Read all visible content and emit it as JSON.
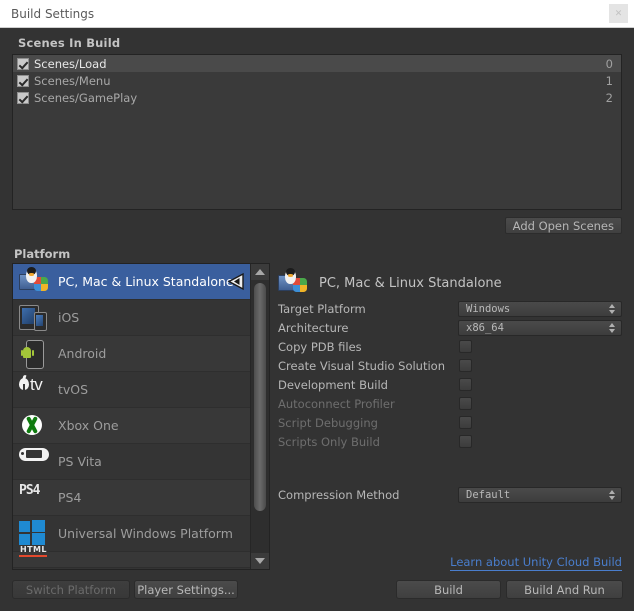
{
  "window": {
    "title": "Build Settings",
    "close_icon": "close-icon",
    "close_glyph": "✕"
  },
  "scenes_section": {
    "header": "Scenes In Build",
    "add_open_scenes_label": "Add Open Scenes",
    "scenes": [
      {
        "name": "Scenes/Load",
        "index": "0",
        "checked": true,
        "selected": true
      },
      {
        "name": "Scenes/Menu",
        "index": "1",
        "checked": true,
        "selected": false
      },
      {
        "name": "Scenes/GamePlay",
        "index": "2",
        "checked": true,
        "selected": false
      }
    ]
  },
  "platform_section": {
    "header": "Platform",
    "selected_platform": "PC, Mac & Linux Standalone",
    "active_target_icon": "unity-logo-icon",
    "scroll_up_icon": "scroll-up-arrow-icon",
    "scroll_down_icon": "scroll-down-arrow-icon",
    "platforms": [
      {
        "label": "PC, Mac & Linux Standalone",
        "icon": "standalone-icon",
        "selected": true
      },
      {
        "label": "iOS",
        "icon": "ios-icon",
        "selected": false
      },
      {
        "label": "Android",
        "icon": "android-icon",
        "selected": false
      },
      {
        "label": "tvOS",
        "icon": "tvos-icon",
        "selected": false
      },
      {
        "label": "Xbox One",
        "icon": "xbox-one-icon",
        "selected": false
      },
      {
        "label": "PS Vita",
        "icon": "ps-vita-icon",
        "selected": false
      },
      {
        "label": "PS4",
        "icon": "ps4-icon",
        "selected": false
      },
      {
        "label": "Universal Windows Platform",
        "icon": "windows-icon",
        "selected": false
      },
      {
        "label": "",
        "icon": "html5-icon",
        "selected": false
      }
    ]
  },
  "settings_panel": {
    "title": "PC, Mac & Linux Standalone",
    "title_icon": "standalone-icon",
    "fields": [
      {
        "label": "Target Platform",
        "type": "popup",
        "value": "Windows",
        "disabled": false
      },
      {
        "label": "Architecture",
        "type": "popup",
        "value": "x86_64",
        "disabled": false
      },
      {
        "label": "Copy PDB files",
        "type": "checkbox",
        "value": false,
        "disabled": false
      },
      {
        "label": "Create Visual Studio Solution",
        "type": "checkbox",
        "value": false,
        "disabled": false
      },
      {
        "label": "Development Build",
        "type": "checkbox",
        "value": false,
        "disabled": false
      },
      {
        "label": "Autoconnect Profiler",
        "type": "checkbox",
        "value": false,
        "disabled": true
      },
      {
        "label": "Script Debugging",
        "type": "checkbox",
        "value": false,
        "disabled": true
      },
      {
        "label": "Scripts Only Build",
        "type": "checkbox",
        "value": false,
        "disabled": true
      }
    ],
    "compression": {
      "label": "Compression Method",
      "value": "Default"
    }
  },
  "footer": {
    "cloud_build_link": "Learn about Unity Cloud Build",
    "switch_platform_label": "Switch Platform",
    "switch_platform_disabled": true,
    "player_settings_label": "Player Settings...",
    "build_label": "Build",
    "build_and_run_label": "Build And Run"
  },
  "colors": {
    "window_bg": "#333333",
    "list_bg": "#3a3a3a",
    "selection_blue": "#3a5f9e",
    "link_blue": "#4a7ecd",
    "titlebar_bg": "#ffffff",
    "text": "#b4b4b4",
    "text_disabled": "#6e6e6e"
  }
}
